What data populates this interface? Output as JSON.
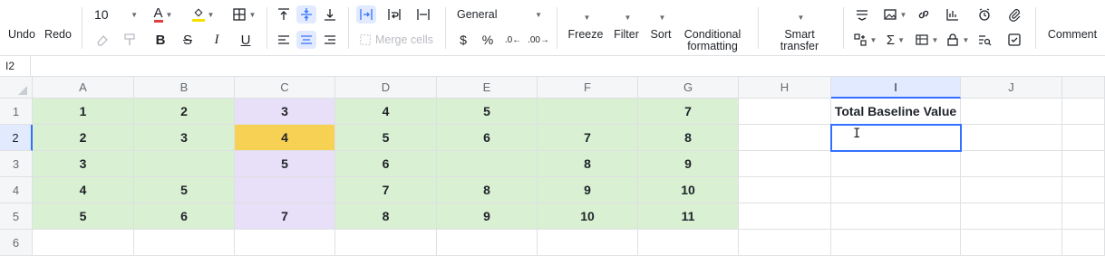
{
  "toolbar": {
    "undo": "Undo",
    "redo": "Redo",
    "font_size": "10",
    "number_format": "General",
    "merge_cells": "Merge cells",
    "currency": "$",
    "percent": "%",
    "freeze": "Freeze",
    "filter": "Filter",
    "sort": "Sort",
    "conditional_formatting_1": "Conditional",
    "conditional_formatting_2": "formatting",
    "smart_transfer_1": "Smart",
    "smart_transfer_2": "transfer",
    "comment": "Comment",
    "font_color": "#e03e3e",
    "fill_color": "#f7e000"
  },
  "formula_bar": {
    "cell_ref": "I2"
  },
  "columns": [
    "A",
    "B",
    "C",
    "D",
    "E",
    "F",
    "G",
    "H",
    "I",
    "J"
  ],
  "rows": [
    "1",
    "2",
    "3",
    "4",
    "5",
    "6"
  ],
  "cells": {
    "r1": [
      "1",
      "2",
      "3",
      "4",
      "5",
      "",
      "7",
      "",
      "Total Baseline Value",
      ""
    ],
    "r2": [
      "2",
      "3",
      "4",
      "5",
      "6",
      "7",
      "8",
      "",
      "",
      ""
    ],
    "r3": [
      "3",
      "",
      "5",
      "6",
      "",
      "8",
      "9",
      "",
      "",
      ""
    ],
    "r4": [
      "4",
      "5",
      "",
      "7",
      "8",
      "9",
      "10",
      "",
      "",
      ""
    ],
    "r5": [
      "5",
      "6",
      "7",
      "8",
      "9",
      "10",
      "11",
      "",
      "",
      ""
    ],
    "r6": [
      "",
      "",
      "",
      "",
      "",
      "",
      "",
      "",
      "",
      ""
    ]
  },
  "colors": {
    "green": "#d9f0d3",
    "purple": "#e8dff8",
    "yellow": "#f7d154",
    "selection": "#3370ff"
  }
}
